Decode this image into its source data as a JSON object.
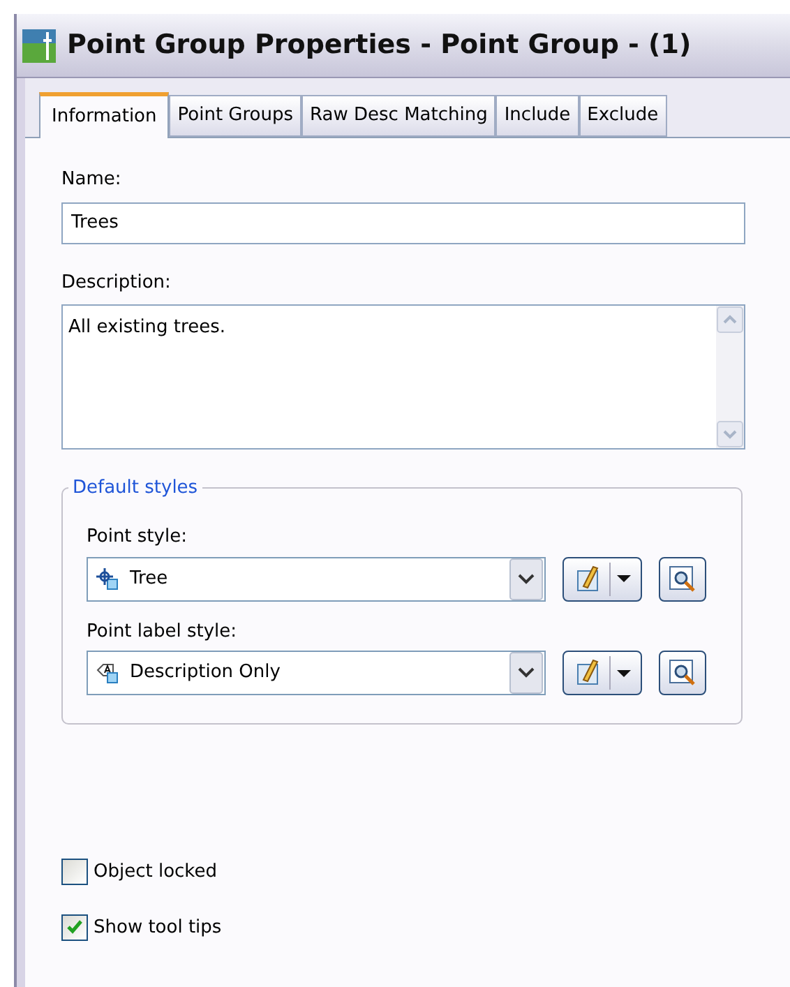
{
  "window": {
    "title": "Point Group Properties - Point Group - (1)"
  },
  "tabs": [
    {
      "label": "Information",
      "selected": true
    },
    {
      "label": "Point Groups",
      "selected": false
    },
    {
      "label": "Raw Desc Matching",
      "selected": false
    },
    {
      "label": "Include",
      "selected": false
    },
    {
      "label": "Exclude",
      "selected": false
    }
  ],
  "name": {
    "label": "Name:",
    "value": "Trees"
  },
  "description": {
    "label": "Description:",
    "value": "All existing trees."
  },
  "default_styles": {
    "title": "Default styles",
    "styles": [
      {
        "label": "Point style:",
        "value": "Tree",
        "kind": "point"
      },
      {
        "label": "Point label style:",
        "value": "Description Only",
        "kind": "label"
      }
    ]
  },
  "options": [
    {
      "label": "Object locked",
      "checked": false
    },
    {
      "label": "Show tool tips",
      "checked": true
    }
  ]
}
